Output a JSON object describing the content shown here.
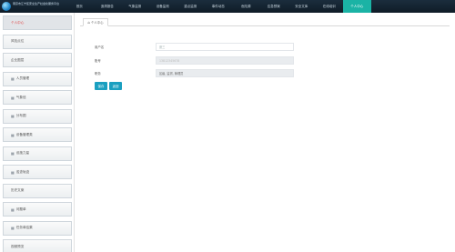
{
  "brand": {
    "title_line1": "南京市江宁区安全生产社会化服务平台",
    "title_line2": ""
  },
  "nav": [
    "首页",
    "追溯报告",
    "气象监测",
    "设备监测",
    "重点监测",
    "事件动态",
    "危险源",
    "应急预案",
    "安全文库",
    "在线培训",
    "个人中心"
  ],
  "nav_active_index": 10,
  "sidebar": [
    {
      "label": "个人中心",
      "icon": "",
      "active": true
    },
    {
      "label": "风险点位",
      "icon": "",
      "active": false
    },
    {
      "label": "企业图层",
      "icon": "",
      "active": false
    },
    {
      "label": "人员管理",
      "icon": "▦",
      "active": false
    },
    {
      "label": "气象信",
      "icon": "▦",
      "active": false
    },
    {
      "label": "分布图",
      "icon": "▦",
      "active": false
    },
    {
      "label": "设备管理类",
      "icon": "▦",
      "active": false
    },
    {
      "label": "设施力量",
      "icon": "▦",
      "active": false
    },
    {
      "label": "巡查轨迹",
      "icon": "▦",
      "active": false
    },
    {
      "label": "历史文案",
      "icon": "",
      "active": false
    },
    {
      "label": "问题单",
      "icon": "▦",
      "active": false
    },
    {
      "label": "任务单结果",
      "icon": "▦",
      "active": false
    },
    {
      "label": "视频预览",
      "icon": "",
      "active": false
    }
  ],
  "breadcrumb": {
    "label": "个人中心"
  },
  "form": {
    "username_label": "用户名",
    "username_value": "张三",
    "account_label": "账号",
    "account_value": "13812345678",
    "role_label": "职务",
    "role_value": "区级, 监督, 管理员"
  },
  "buttons": {
    "save": "保存",
    "back": "返回"
  }
}
